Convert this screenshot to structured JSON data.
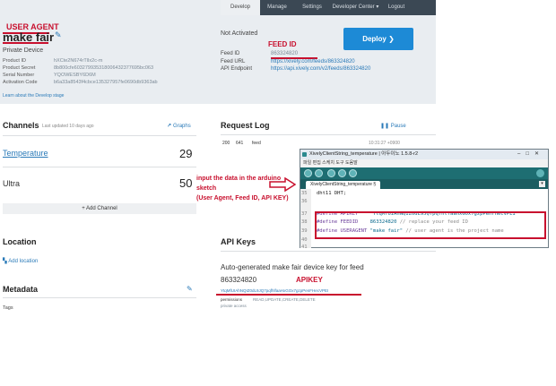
{
  "nav": {
    "develop": "Develop",
    "manage": "Manage",
    "settings": "Settings",
    "developer_center": "Developer Center ▾",
    "logout": "Logout"
  },
  "annotations": {
    "user_agent": "USER AGENT",
    "feed_id": "FEED ID",
    "instructions": [
      "input the data in the arduino",
      "sketch",
      "(User Agent, Feed ID, API KEY)"
    ],
    "apikey": "APIKEY"
  },
  "device": {
    "title": "make fair",
    "subtitle": "Private Device",
    "props": [
      {
        "label": "Product ID",
        "value": "hXCte2N674rTlIx2c-m"
      },
      {
        "label": "Product Secret",
        "value": "8b800cfe603279935318006432377695bc063"
      },
      {
        "label": "Serial Number",
        "value": "YQOWESBY6D6M"
      },
      {
        "label": "Activation Code",
        "value": "b6a33a8543f4cbce135327957fe0690db9363ab"
      }
    ],
    "learn_link": "Learn about the Develop stage"
  },
  "feed": {
    "status": "Not Activated",
    "deploy_label": "Deploy ❯",
    "rows": [
      {
        "label": "Feed ID",
        "value": "863324820"
      },
      {
        "label": "Feed URL",
        "value": "https://xively.com/feeds/863324820"
      },
      {
        "label": "API Endpoint",
        "value": "https://api.xively.com/v2/feeds/863324820"
      }
    ]
  },
  "channels": {
    "title": "Channels",
    "updated": "Last updated 10 days ago",
    "graphs_label": "Graphs",
    "items": [
      {
        "name": "Temperature",
        "value": "29"
      },
      {
        "name": "Ultra",
        "value": "50"
      }
    ],
    "add_channel": "+ Add Channel"
  },
  "location": {
    "title": "Location",
    "add_link": "Add location"
  },
  "metadata": {
    "title": "Metadata",
    "tags_label": "Tags"
  },
  "request_log": {
    "title": "Request Log",
    "pause_label": "Pause",
    "entry": {
      "code": "200",
      "size": "641",
      "resource": "feed",
      "time": "10:31:27 +0900"
    }
  },
  "arduino": {
    "title": "XivelyClientString_temperature | 아두이노 1.5.8-r2",
    "menu": "파일  편집  스케치  도구  도움말",
    "tab": "XivelyClientString_temperature §",
    "lines": [
      {
        "num": "35",
        "code": "dht11 DHT;"
      },
      {
        "num": "36",
        "code": ""
      },
      {
        "num": "37",
        "kw": "#define APIKEY",
        "str": "\"YtqMfUIAhNQIZ0dL9JQ7pqfhlfaaHxGOx7gzpPenFHecVPEI\"",
        "cm": ""
      },
      {
        "num": "38",
        "kw": "#define FEEDID",
        "str": "863324820",
        "cm": "// replace your feed ID"
      },
      {
        "num": "39",
        "kw": "#define USERAGENT",
        "str": "\"make fair\"",
        "cm": "// user agent is the project name"
      },
      {
        "num": "40",
        "code": ""
      },
      {
        "num": "41",
        "code": ""
      }
    ]
  },
  "api_keys": {
    "title": "API Keys",
    "desc": "Auto-generated make fair device key for feed",
    "feed_id": "863324820",
    "key": "YtqMfUIAhNQIZ0dL9JQ7pqfhlfaaHxGOx7gzpPenFHecVPEI",
    "permissions_label": "permissions",
    "permissions_value": "READ,UPDATE,CREATE,DELETE",
    "private_access": "private access"
  },
  "colors": {
    "annotation_red": "#c8102e",
    "link_blue": "#2a7ab8",
    "deploy_blue": "#1d8ad6",
    "navbar": "#3b4854",
    "arduino_teal": "#1e6e72"
  }
}
